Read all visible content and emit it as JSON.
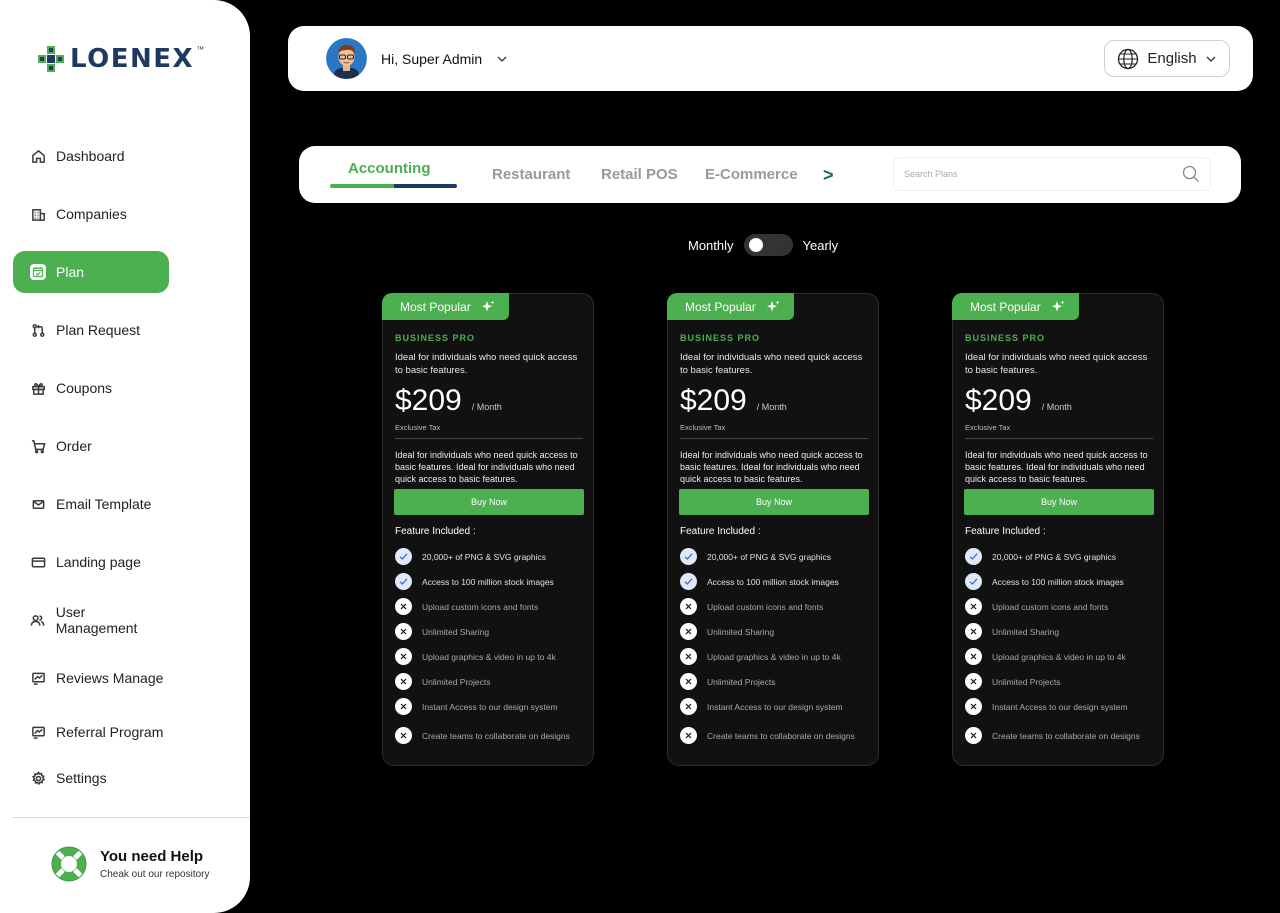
{
  "brand": {
    "name": "LOENEX",
    "tm": "™",
    "colors": {
      "primary": "#4caf50",
      "navy": "#1f3a60"
    }
  },
  "sidebar": {
    "items": [
      {
        "label": "Dashboard",
        "icon": "home-icon"
      },
      {
        "label": "Companies",
        "icon": "building-icon"
      },
      {
        "label": "Plan",
        "icon": "calendar-check-icon",
        "active": true
      },
      {
        "label": "Plan Request",
        "icon": "git-pull-request-icon"
      },
      {
        "label": "Coupons",
        "icon": "gift-icon"
      },
      {
        "label": "Order",
        "icon": "cart-icon"
      },
      {
        "label": "Email Template",
        "icon": "mail-icon"
      },
      {
        "label": "Landing page",
        "icon": "credit-card-icon"
      },
      {
        "label": "User Management",
        "icon": "users-icon"
      },
      {
        "label": "Reviews Manage",
        "icon": "chart-board-icon"
      },
      {
        "label": "Referral Program",
        "icon": "chart-board-icon"
      },
      {
        "label": "Settings",
        "icon": "gear-icon"
      }
    ],
    "help": {
      "title": "You need  Help",
      "subtitle": "Cheak out our repository"
    }
  },
  "header": {
    "greeting": "Hi, Super Admin",
    "language": "English"
  },
  "categories": {
    "tabs": [
      "Accounting",
      "Restaurant",
      "Retail POS",
      "E-Commerce"
    ],
    "active": "Accounting",
    "next_label": ">",
    "search_placeholder": "Search Plans"
  },
  "billing": {
    "monthly_label": "Monthly",
    "yearly_label": "Yearly",
    "selected": "Monthly"
  },
  "plans": [
    {
      "badge": "Most Popular",
      "name": "BUSINESS PRO",
      "description": "Ideal for individuals who need quick access to basic features.",
      "price": "$209",
      "period": "/ Month",
      "tax_note": "Exclusive Tax",
      "long_description": "Ideal for individuals who need quick access to basic features. Ideal for individuals who need quick access to basic features.",
      "cta": "Buy Now",
      "features_title": "Feature Included :",
      "features": [
        {
          "label": "20,000+ of PNG & SVG graphics",
          "included": true
        },
        {
          "label": "Access to 100 million stock images",
          "included": true
        },
        {
          "label": "Upload custom icons and fonts",
          "included": false
        },
        {
          "label": "Unlimited Sharing",
          "included": false
        },
        {
          "label": "Upload graphics & video in up to 4k",
          "included": false
        },
        {
          "label": "Unlimited Projects",
          "included": false
        },
        {
          "label": "Instant Access to our design system",
          "included": false
        },
        {
          "label": "Create teams to collaborate on designs",
          "included": false
        }
      ]
    },
    {
      "badge": "Most Popular",
      "name": "BUSINESS PRO",
      "description": "Ideal for individuals who need quick access to basic features.",
      "price": "$209",
      "period": "/ Month",
      "tax_note": "Exclusive Tax",
      "long_description": "Ideal for individuals who need quick access to basic features. Ideal for individuals who need quick access to basic features.",
      "cta": "Buy Now",
      "features_title": "Feature Included :",
      "features": [
        {
          "label": "20,000+ of PNG & SVG graphics",
          "included": true
        },
        {
          "label": "Access to 100 million stock images",
          "included": true
        },
        {
          "label": "Upload custom icons and fonts",
          "included": false
        },
        {
          "label": "Unlimited Sharing",
          "included": false
        },
        {
          "label": "Upload graphics & video in up to 4k",
          "included": false
        },
        {
          "label": "Unlimited Projects",
          "included": false
        },
        {
          "label": "Instant Access to our design system",
          "included": false
        },
        {
          "label": "Create teams to collaborate on designs",
          "included": false
        }
      ]
    },
    {
      "badge": "Most Popular",
      "name": "BUSINESS PRO",
      "description": "Ideal for individuals who need quick access to basic features.",
      "price": "$209",
      "period": "/ Month",
      "tax_note": "Exclusive Tax",
      "long_description": "Ideal for individuals who need quick access to basic features. Ideal for individuals who need quick access to basic features.",
      "cta": "Buy Now",
      "features_title": "Feature Included :",
      "features": [
        {
          "label": "20,000+ of PNG & SVG graphics",
          "included": true
        },
        {
          "label": "Access to 100 million stock images",
          "included": true
        },
        {
          "label": "Upload custom icons and fonts",
          "included": false
        },
        {
          "label": "Unlimited Sharing",
          "included": false
        },
        {
          "label": "Upload graphics & video in up to 4k",
          "included": false
        },
        {
          "label": "Unlimited Projects",
          "included": false
        },
        {
          "label": "Instant Access to our design system",
          "included": false
        },
        {
          "label": "Create teams to collaborate on designs",
          "included": false
        }
      ]
    }
  ]
}
